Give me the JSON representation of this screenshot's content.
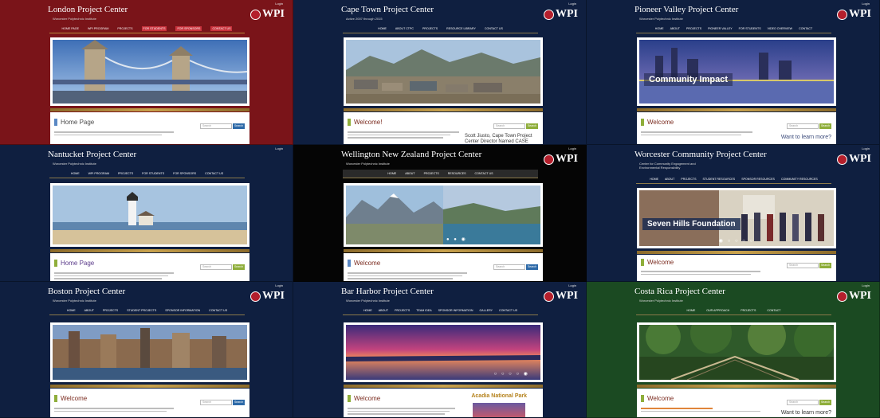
{
  "tiles": [
    {
      "title": "London Project Center",
      "subtitle": "Worcester Polytechnic Institute",
      "login": "Login",
      "logo": "WPI",
      "nav": [
        "HOME PAGE",
        "WPI PROGRAM",
        "PROJECTS",
        "FOR STUDENTS",
        "FOR SPONSORS",
        "CONTACT US"
      ],
      "panel_title": "Home Page",
      "search_placeholder": "Search",
      "search_button": "Search",
      "side_text": "",
      "caption": "",
      "colors": {
        "bg": "#7a1419",
        "nav_active": "#c9323c"
      }
    },
    {
      "title": "Cape Town Project Center",
      "subtitle": "Active 2007 through 2015",
      "login": "Login",
      "logo": "WPI",
      "nav": [
        "HOME",
        "ABOUT CTPC",
        "PROJECTS",
        "RESOURCE LIBRARY",
        "CONTACT US"
      ],
      "panel_title": "Welcome!",
      "search_placeholder": "Search",
      "search_button": "Search",
      "side_text": "Scott Jiusto, Cape Town Project\nCenter Director Named CASE",
      "caption": "",
      "colors": {
        "bg": "#0f1f40"
      }
    },
    {
      "title": "Pioneer Valley Project Center",
      "subtitle": "Worcester Polytechnic Institute",
      "login": "Login",
      "logo": "WPI",
      "nav": [
        "HOME",
        "ABOUT",
        "PROJECTS",
        "PIONEER VALLEY",
        "FOR STUDENTS",
        "VIDEO OVERVIEW",
        "CONTACT"
      ],
      "panel_title": "Welcome",
      "search_placeholder": "Search",
      "search_button": "Search",
      "side_text": "Want to learn more?",
      "caption": "Community Impact",
      "colors": {
        "bg": "#0f1f40"
      }
    },
    {
      "title": "Nantucket Project Center",
      "subtitle": "Worcester Polytechnic Institute",
      "login": "Login",
      "logo": "WPI",
      "nav": [
        "HOME",
        "WPI PROGRAM",
        "PROJECTS",
        "FOR STUDENTS",
        "FOR SPONSORS",
        "CONTACT US"
      ],
      "panel_title": "Home Page",
      "search_placeholder": "Search",
      "search_button": "Search",
      "side_text": "",
      "caption": "",
      "colors": {
        "bg": "#0f1f40"
      }
    },
    {
      "title": "Wellington New Zealand Project Center",
      "subtitle": "Worcester Polytechnic Institute",
      "login": "Login",
      "logo": "WPI",
      "nav": [
        "HOME",
        "ABOUT",
        "PROJECTS",
        "RESOURCES",
        "CONTACT US"
      ],
      "panel_title": "Welcome",
      "search_placeholder": "Search",
      "search_button": "Search",
      "side_text": "",
      "caption": "",
      "colors": {
        "bg": "#050505"
      }
    },
    {
      "title": "Worcester Community Project Center",
      "subtitle": "Center for Community Engagement and\nEnvironmental Responsibility",
      "login": "Login",
      "logo": "WPI",
      "nav": [
        "HOME",
        "ABOUT",
        "PROJECTS",
        "STUDENT RESOURCES",
        "SPONSOR RESOURCES",
        "COMMUNITY RESOURCES"
      ],
      "panel_title": "Welcome",
      "search_placeholder": "Search",
      "search_button": "Search",
      "side_text": "",
      "caption": "Seven Hills Foundation",
      "colors": {
        "bg": "#0f1f40"
      }
    },
    {
      "title": "Boston Project Center",
      "subtitle": "Worcester Polytechnic Institute",
      "login": "Login",
      "logo": "WPI",
      "nav": [
        "HOME",
        "ABOUT",
        "PROJECTS",
        "STUDENT PROJECTS",
        "SPONSOR INFORMATION",
        "CONTACT US"
      ],
      "panel_title": "Welcome",
      "search_placeholder": "Search",
      "search_button": "Search",
      "side_text": "",
      "caption": "",
      "colors": {
        "bg": "#0f1f40"
      }
    },
    {
      "title": "Bar Harbor Project Center",
      "subtitle": "Worcester Polytechnic Institute",
      "login": "Login",
      "logo": "WPI",
      "nav": [
        "HOME",
        "ABOUT",
        "PROJECTS",
        "TEAM IDEA",
        "SPONSOR INFORMATION",
        "GALLERY",
        "CONTACT US"
      ],
      "panel_title": "Welcome",
      "search_placeholder": "Search",
      "search_button": "Search",
      "side_text": "Acadia National Park",
      "caption": "",
      "colors": {
        "bg": "#0f1f40"
      }
    },
    {
      "title": "Costa Rica Project Center",
      "subtitle": "Worcester Polytechnic Institute",
      "login": "Login",
      "logo": "WPI",
      "nav": [
        "HOME",
        "OUR APPROACH",
        "PROJECTS",
        "CONTACT"
      ],
      "panel_title": "Welcome",
      "search_placeholder": "Search",
      "search_button": "Search",
      "side_text": "Want to learn more?",
      "caption": "",
      "colors": {
        "bg": "#1b4a22"
      }
    }
  ]
}
